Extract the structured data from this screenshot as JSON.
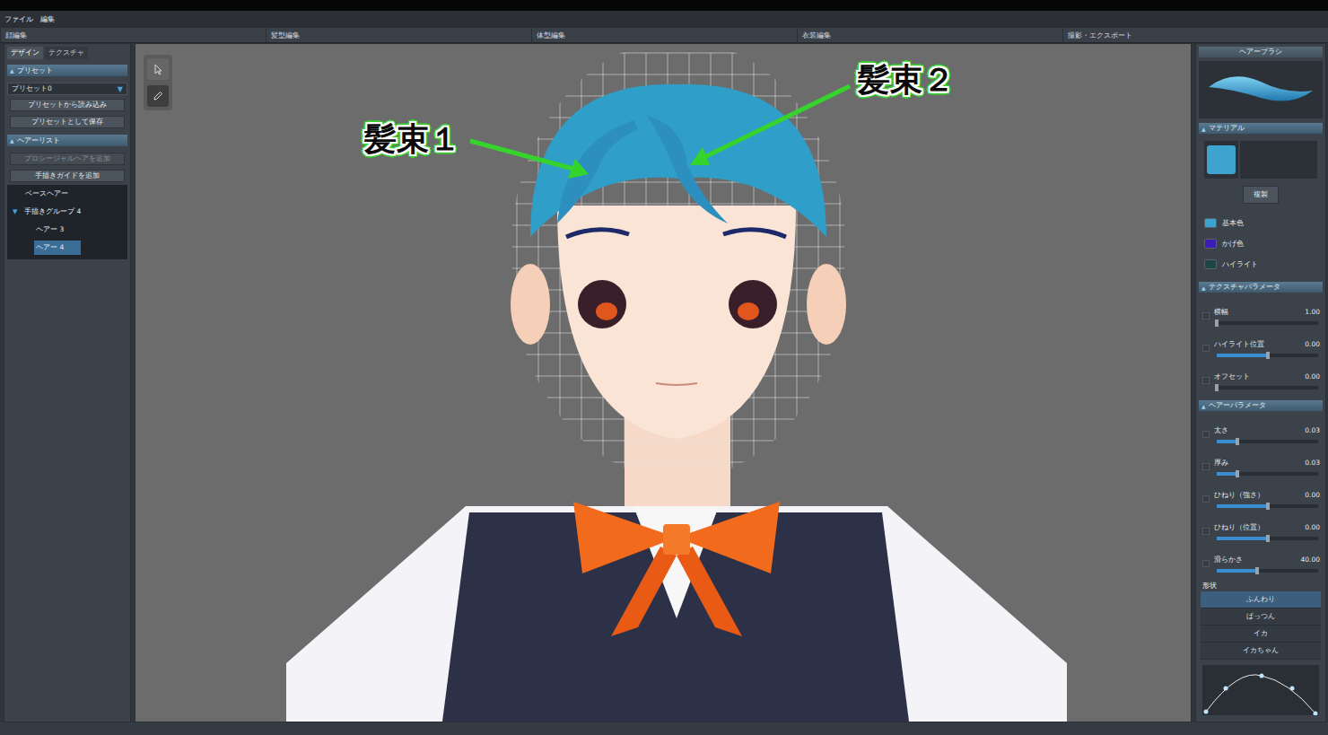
{
  "menu": [
    "ファイル",
    "編集"
  ],
  "mode_tabs": [
    {
      "label": "顔編集",
      "selected": false
    },
    {
      "label": "髪型編集",
      "selected": false
    },
    {
      "label": "体型編集",
      "selected": false
    },
    {
      "label": "衣装編集",
      "selected": false
    },
    {
      "label": "撮影・エクスポート",
      "selected": false
    }
  ],
  "left_panel": {
    "tabs": [
      {
        "label": "デザイン",
        "selected": true
      },
      {
        "label": "テクスチャ",
        "selected": false
      }
    ],
    "preset_section": {
      "title": "プリセット",
      "toggle": "▲",
      "expanded": true
    },
    "preset_select": {
      "value": "プリセット0",
      "arrow": "▼"
    },
    "preset_buttons": [
      {
        "label": "プリセットから読み込み",
        "disabled": false
      },
      {
        "label": "プリセットとして保存",
        "disabled": false
      }
    ],
    "hair_section": {
      "title": "ヘアーリスト",
      "toggle": "▲",
      "expanded": true
    },
    "hair_buttons": [
      {
        "label": "プロシージャルヘアを追加",
        "disabled": true
      },
      {
        "label": "手描きガイドを追加",
        "disabled": false
      }
    ],
    "tree": [
      {
        "label": "ベースヘアー",
        "depth": 1,
        "toggle": "",
        "selected": false
      },
      {
        "label": "手描きグループ 4",
        "depth": 0,
        "toggle": "▼",
        "selected": false
      },
      {
        "label": "ヘアー 3",
        "depth": 2,
        "toggle": "",
        "selected": false
      },
      {
        "label": "ヘアー 4",
        "depth": 2,
        "toggle": "",
        "selected": true
      }
    ]
  },
  "viewport": {
    "tools": [
      {
        "kind": "select",
        "selected": false
      },
      {
        "kind": "pen",
        "selected": true
      }
    ],
    "annotations": [
      {
        "label": "髪束１"
      },
      {
        "label": "髪束２"
      }
    ]
  },
  "right_panel": {
    "brush": {
      "title": "ヘアーブラシ"
    },
    "material": {
      "title": "マテリアル",
      "toggle": "▲",
      "swatch": "#3ea3cf",
      "copy_button": "複製",
      "colors": [
        {
          "label": "基本色",
          "color": "#3ba3d0"
        },
        {
          "label": "かげ色",
          "color": "#3b1db5"
        },
        {
          "label": "ハイライト",
          "color": "#1e4646"
        }
      ]
    },
    "texture_params": {
      "title": "テクスチャパラメータ",
      "toggle": "▲",
      "sliders": [
        {
          "label": "横幅",
          "value": "1.00",
          "level": 0.0,
          "checked": false
        },
        {
          "label": "ハイライト位置",
          "value": "0.00",
          "level": 0.5,
          "checked": false
        },
        {
          "label": "オフセット",
          "value": "0.00",
          "level": 0.0,
          "checked": false
        }
      ]
    },
    "hair_params": {
      "title": "ヘアーパラメータ",
      "toggle": "▲",
      "sliders": [
        {
          "label": "太さ",
          "value": "0.03",
          "level": 0.2,
          "checked": false
        },
        {
          "label": "厚み",
          "value": "0.03",
          "level": 0.2,
          "checked": false
        },
        {
          "label": "ひねり（強さ）",
          "value": "0.00",
          "level": 0.5,
          "checked": false
        },
        {
          "label": "ひねり（位置）",
          "value": "0.00",
          "level": 0.5,
          "checked": false
        },
        {
          "label": "滑らかさ",
          "value": "40.00",
          "level": 0.4,
          "checked": false
        }
      ]
    },
    "shape": {
      "title": "形状",
      "options": [
        {
          "label": "ふんわり",
          "selected": true
        },
        {
          "label": "ぱっつん",
          "selected": false
        },
        {
          "label": "イカ",
          "selected": false
        },
        {
          "label": "イカちゃん",
          "selected": false
        }
      ]
    }
  }
}
